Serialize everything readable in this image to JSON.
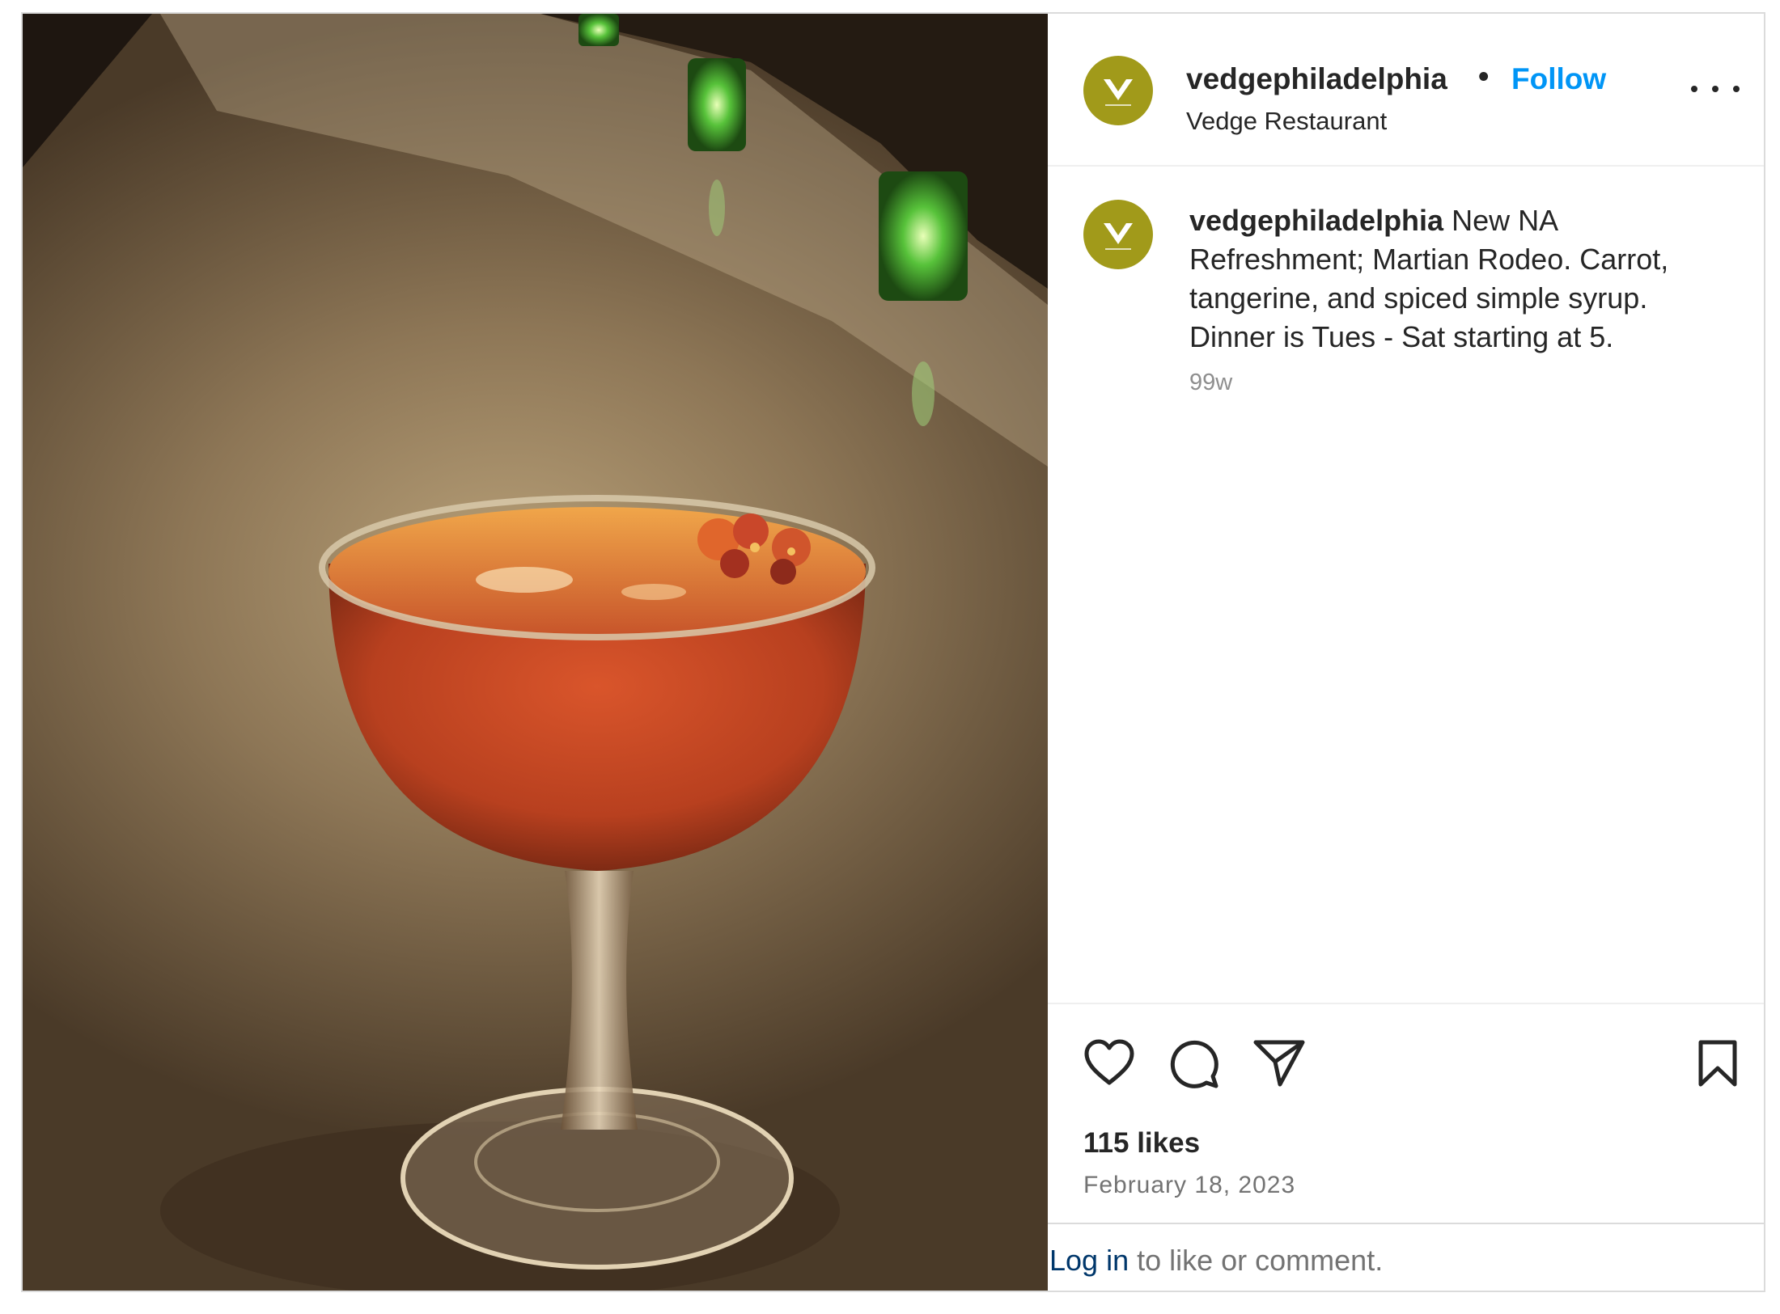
{
  "post": {
    "username": "vedgephiladelphia",
    "separator": "•",
    "follow_label": "Follow",
    "subtitle": "Vedge Restaurant",
    "more_icon": "ellipsis-icon",
    "avatar_logo": "V",
    "brand_color": "#a19a1a"
  },
  "caption": {
    "username": "vedgephiladelphia",
    "text": " New NA Refreshment; Martian Rodeo. Carrot, tangerine, and spiced simple syrup. Dinner is Tues - Sat starting at 5.",
    "age": "99w"
  },
  "actions": {
    "like_icon": "heart-icon",
    "comment_icon": "comment-icon",
    "share_icon": "paper-plane-icon",
    "save_icon": "bookmark-icon"
  },
  "stats": {
    "likes": "115 likes",
    "date": "February 18, 2023"
  },
  "footer": {
    "login_link": "Log in",
    "login_rest": " to like or comment."
  },
  "colors": {
    "follow": "#0095f6",
    "login_link": "#00376b",
    "muted": "#737373"
  }
}
